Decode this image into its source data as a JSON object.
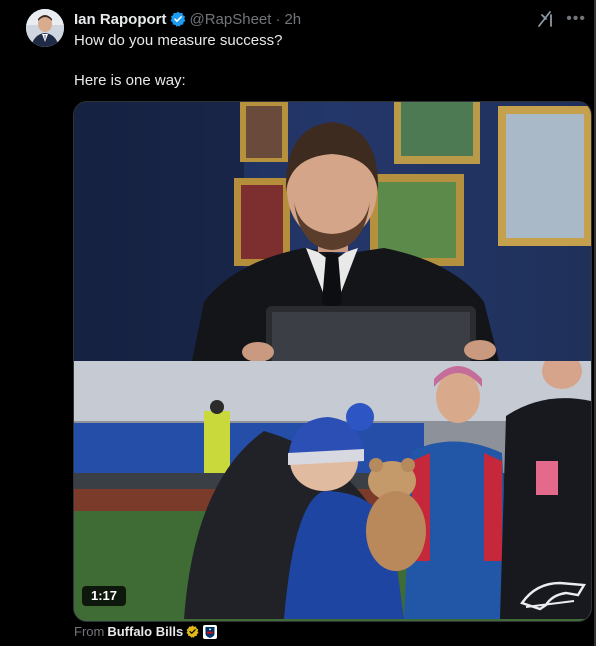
{
  "post": {
    "author_name": "Ian Rapoport",
    "handle": "@RapSheet",
    "separator": "·",
    "time": "2h",
    "text": "How do you measure success?\n\nHere is one way:"
  },
  "media": {
    "duration": "1:17"
  },
  "source": {
    "prefix": "From",
    "name": "Buffalo Bills"
  },
  "icons": {
    "verified": "verified-badge-icon",
    "grok": "grok-icon",
    "more": "more-options-icon",
    "gold_badge": "gold-verified-badge-icon",
    "affiliate": "nfl-affiliate-icon"
  },
  "colors": {
    "background": "#000000",
    "text": "#e7e9ea",
    "muted": "#71767b",
    "verified_blue": "#1d9bf0",
    "gold": "#e2b719"
  }
}
